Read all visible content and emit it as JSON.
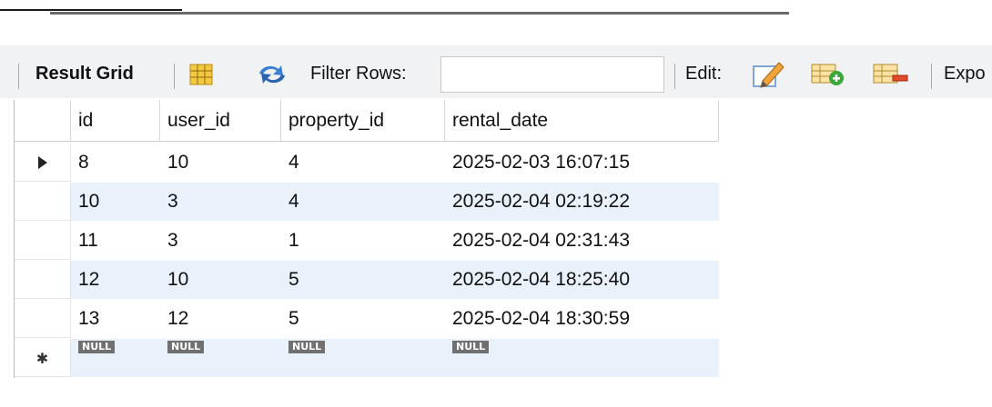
{
  "toolbar": {
    "result_grid_label": "Result Grid",
    "filter_rows_label": "Filter Rows:",
    "filter_value": "",
    "edit_label": "Edit:",
    "export_label": "Expo",
    "icons": [
      "grid-layout-icon",
      "refresh-icon",
      "edit-pencil-icon",
      "add-row-icon",
      "delete-row-icon"
    ]
  },
  "grid": {
    "columns": [
      "id",
      "user_id",
      "property_id",
      "rental_date"
    ],
    "rows": [
      {
        "id": "8",
        "user_id": "10",
        "property_id": "4",
        "rental_date": "2025-02-03 16:07:15",
        "current": true
      },
      {
        "id": "10",
        "user_id": "3",
        "property_id": "4",
        "rental_date": "2025-02-04 02:19:22"
      },
      {
        "id": "11",
        "user_id": "3",
        "property_id": "1",
        "rental_date": "2025-02-04 02:31:43"
      },
      {
        "id": "12",
        "user_id": "10",
        "property_id": "5",
        "rental_date": "2025-02-04 18:25:40"
      },
      {
        "id": "13",
        "user_id": "12",
        "property_id": "5",
        "rental_date": "2025-02-04 18:30:59"
      }
    ],
    "new_row_markers": [
      "NULL",
      "NULL",
      "NULL",
      "NULL"
    ]
  },
  "colors": {
    "toolbar_bg": "#f1f2f4",
    "alt_row": "#e9f1fb",
    "null_badge": "#707070",
    "refresh_icon": "#3a7fd0"
  }
}
